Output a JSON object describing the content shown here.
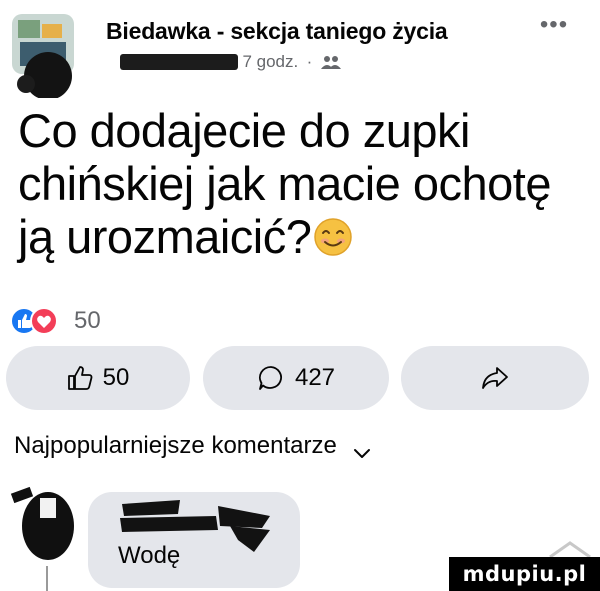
{
  "header": {
    "group_name": "Biedawka - sekcja taniego życia",
    "more_label": "•••",
    "time": "7 godz.",
    "separator": "·"
  },
  "post": {
    "text": "Co dodajecie do zupki chińskiej jak macie ochotę ją urozmaicić?"
  },
  "reactions": {
    "count": "50"
  },
  "actions": {
    "like_count": "50",
    "comment_count": "427"
  },
  "sort": {
    "label": "Najpopularniejsze komentarze"
  },
  "comment": {
    "text": "Wodę"
  },
  "watermark": {
    "text": "mdupiu.pl"
  },
  "colors": {
    "like_blue": "#1877f2",
    "love_red": "#f33e58",
    "pill_bg": "#e4e6eb",
    "muted_text": "#65676b"
  }
}
